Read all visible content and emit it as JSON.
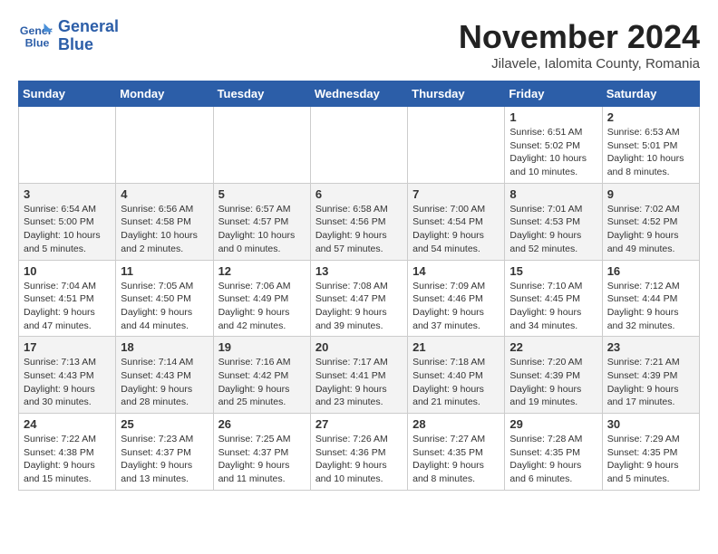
{
  "header": {
    "logo_line1": "General",
    "logo_line2": "Blue",
    "month": "November 2024",
    "location": "Jilavele, Ialomita County, Romania"
  },
  "days_of_week": [
    "Sunday",
    "Monday",
    "Tuesday",
    "Wednesday",
    "Thursday",
    "Friday",
    "Saturday"
  ],
  "weeks": [
    [
      {
        "day": "",
        "info": ""
      },
      {
        "day": "",
        "info": ""
      },
      {
        "day": "",
        "info": ""
      },
      {
        "day": "",
        "info": ""
      },
      {
        "day": "",
        "info": ""
      },
      {
        "day": "1",
        "info": "Sunrise: 6:51 AM\nSunset: 5:02 PM\nDaylight: 10 hours and 10 minutes."
      },
      {
        "day": "2",
        "info": "Sunrise: 6:53 AM\nSunset: 5:01 PM\nDaylight: 10 hours and 8 minutes."
      }
    ],
    [
      {
        "day": "3",
        "info": "Sunrise: 6:54 AM\nSunset: 5:00 PM\nDaylight: 10 hours and 5 minutes."
      },
      {
        "day": "4",
        "info": "Sunrise: 6:56 AM\nSunset: 4:58 PM\nDaylight: 10 hours and 2 minutes."
      },
      {
        "day": "5",
        "info": "Sunrise: 6:57 AM\nSunset: 4:57 PM\nDaylight: 10 hours and 0 minutes."
      },
      {
        "day": "6",
        "info": "Sunrise: 6:58 AM\nSunset: 4:56 PM\nDaylight: 9 hours and 57 minutes."
      },
      {
        "day": "7",
        "info": "Sunrise: 7:00 AM\nSunset: 4:54 PM\nDaylight: 9 hours and 54 minutes."
      },
      {
        "day": "8",
        "info": "Sunrise: 7:01 AM\nSunset: 4:53 PM\nDaylight: 9 hours and 52 minutes."
      },
      {
        "day": "9",
        "info": "Sunrise: 7:02 AM\nSunset: 4:52 PM\nDaylight: 9 hours and 49 minutes."
      }
    ],
    [
      {
        "day": "10",
        "info": "Sunrise: 7:04 AM\nSunset: 4:51 PM\nDaylight: 9 hours and 47 minutes."
      },
      {
        "day": "11",
        "info": "Sunrise: 7:05 AM\nSunset: 4:50 PM\nDaylight: 9 hours and 44 minutes."
      },
      {
        "day": "12",
        "info": "Sunrise: 7:06 AM\nSunset: 4:49 PM\nDaylight: 9 hours and 42 minutes."
      },
      {
        "day": "13",
        "info": "Sunrise: 7:08 AM\nSunset: 4:47 PM\nDaylight: 9 hours and 39 minutes."
      },
      {
        "day": "14",
        "info": "Sunrise: 7:09 AM\nSunset: 4:46 PM\nDaylight: 9 hours and 37 minutes."
      },
      {
        "day": "15",
        "info": "Sunrise: 7:10 AM\nSunset: 4:45 PM\nDaylight: 9 hours and 34 minutes."
      },
      {
        "day": "16",
        "info": "Sunrise: 7:12 AM\nSunset: 4:44 PM\nDaylight: 9 hours and 32 minutes."
      }
    ],
    [
      {
        "day": "17",
        "info": "Sunrise: 7:13 AM\nSunset: 4:43 PM\nDaylight: 9 hours and 30 minutes."
      },
      {
        "day": "18",
        "info": "Sunrise: 7:14 AM\nSunset: 4:43 PM\nDaylight: 9 hours and 28 minutes."
      },
      {
        "day": "19",
        "info": "Sunrise: 7:16 AM\nSunset: 4:42 PM\nDaylight: 9 hours and 25 minutes."
      },
      {
        "day": "20",
        "info": "Sunrise: 7:17 AM\nSunset: 4:41 PM\nDaylight: 9 hours and 23 minutes."
      },
      {
        "day": "21",
        "info": "Sunrise: 7:18 AM\nSunset: 4:40 PM\nDaylight: 9 hours and 21 minutes."
      },
      {
        "day": "22",
        "info": "Sunrise: 7:20 AM\nSunset: 4:39 PM\nDaylight: 9 hours and 19 minutes."
      },
      {
        "day": "23",
        "info": "Sunrise: 7:21 AM\nSunset: 4:39 PM\nDaylight: 9 hours and 17 minutes."
      }
    ],
    [
      {
        "day": "24",
        "info": "Sunrise: 7:22 AM\nSunset: 4:38 PM\nDaylight: 9 hours and 15 minutes."
      },
      {
        "day": "25",
        "info": "Sunrise: 7:23 AM\nSunset: 4:37 PM\nDaylight: 9 hours and 13 minutes."
      },
      {
        "day": "26",
        "info": "Sunrise: 7:25 AM\nSunset: 4:37 PM\nDaylight: 9 hours and 11 minutes."
      },
      {
        "day": "27",
        "info": "Sunrise: 7:26 AM\nSunset: 4:36 PM\nDaylight: 9 hours and 10 minutes."
      },
      {
        "day": "28",
        "info": "Sunrise: 7:27 AM\nSunset: 4:35 PM\nDaylight: 9 hours and 8 minutes."
      },
      {
        "day": "29",
        "info": "Sunrise: 7:28 AM\nSunset: 4:35 PM\nDaylight: 9 hours and 6 minutes."
      },
      {
        "day": "30",
        "info": "Sunrise: 7:29 AM\nSunset: 4:35 PM\nDaylight: 9 hours and 5 minutes."
      }
    ]
  ]
}
